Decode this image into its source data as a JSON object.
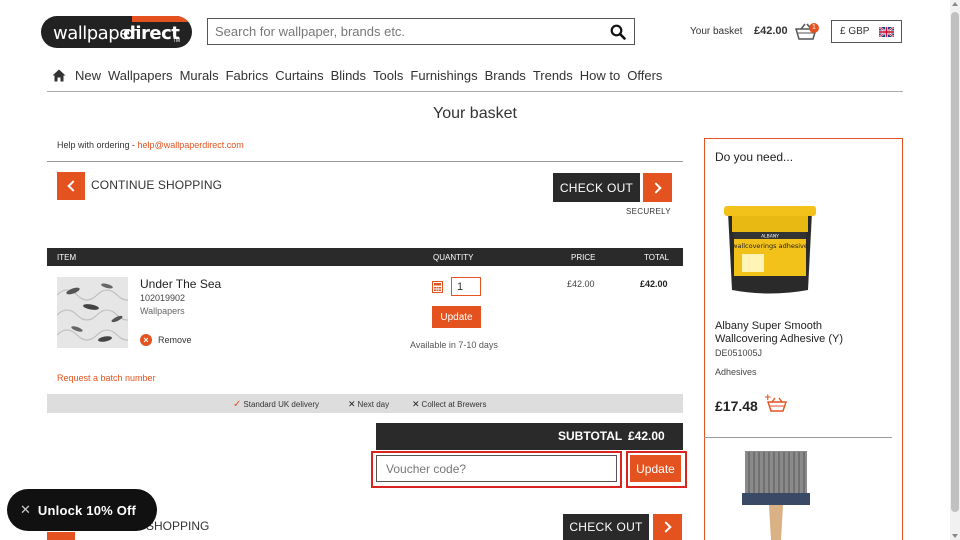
{
  "header": {
    "logo_text_a": "wallpaper",
    "logo_text_b": "direct",
    "logo_tm": "TM",
    "search_placeholder": "Search for wallpaper, brands etc.",
    "basket_label": "Your basket",
    "basket_total": "£42.00",
    "basket_count": "1",
    "currency": "£ GBP"
  },
  "nav": {
    "items": [
      "New",
      "Wallpapers",
      "Murals",
      "Fabrics",
      "Curtains",
      "Blinds",
      "Tools",
      "Furnishings",
      "Brands",
      "Trends",
      "How to",
      "Offers"
    ]
  },
  "page": {
    "title": "Your basket"
  },
  "help": {
    "text": "Help with ordering - ",
    "email": "help@wallpaperdirect.com"
  },
  "actions": {
    "continue_label": "CONTINUE SHOPPING",
    "checkout_label": "CHECK OUT",
    "securely_label": "SECURELY",
    "bottom_continue_fragment": "SHOPPING"
  },
  "table": {
    "headers": [
      "ITEM",
      "QUANTITY",
      "PRICE",
      "TOTAL"
    ]
  },
  "line_item": {
    "name": "Under The Sea",
    "code": "102019902",
    "category": "Wallpapers",
    "remove_label": "Remove",
    "quantity": "1",
    "update_label": "Update",
    "availability": "Available in 7-10 days",
    "price": "£42.00",
    "total": "£42.00"
  },
  "batch_link": "Request a batch number",
  "delivery": {
    "options": [
      {
        "label": "Standard UK delivery",
        "available": true
      },
      {
        "label": "Next day",
        "available": false
      },
      {
        "label": "Collect at Brewers",
        "available": false
      }
    ]
  },
  "summary": {
    "subtotal_label": "SUBTOTAL",
    "subtotal_value": "£42.00",
    "voucher_placeholder": "Voucher code?",
    "voucher_update": "Update"
  },
  "promo": {
    "label": "Unlock 10% Off"
  },
  "upsell": {
    "title": "Do you need...",
    "product": {
      "name": "Albany Super Smooth Wallcovering Adhesive (Y)",
      "code": "DE051005J",
      "category": "Adhesives",
      "price": "£17.48",
      "tub_brand": "ALBANY",
      "tub_label": "wallcoverings adhesive"
    }
  },
  "colors": {
    "accent": "#e4531f",
    "dark": "#2a2a2a",
    "highlight": "#d9241f"
  }
}
